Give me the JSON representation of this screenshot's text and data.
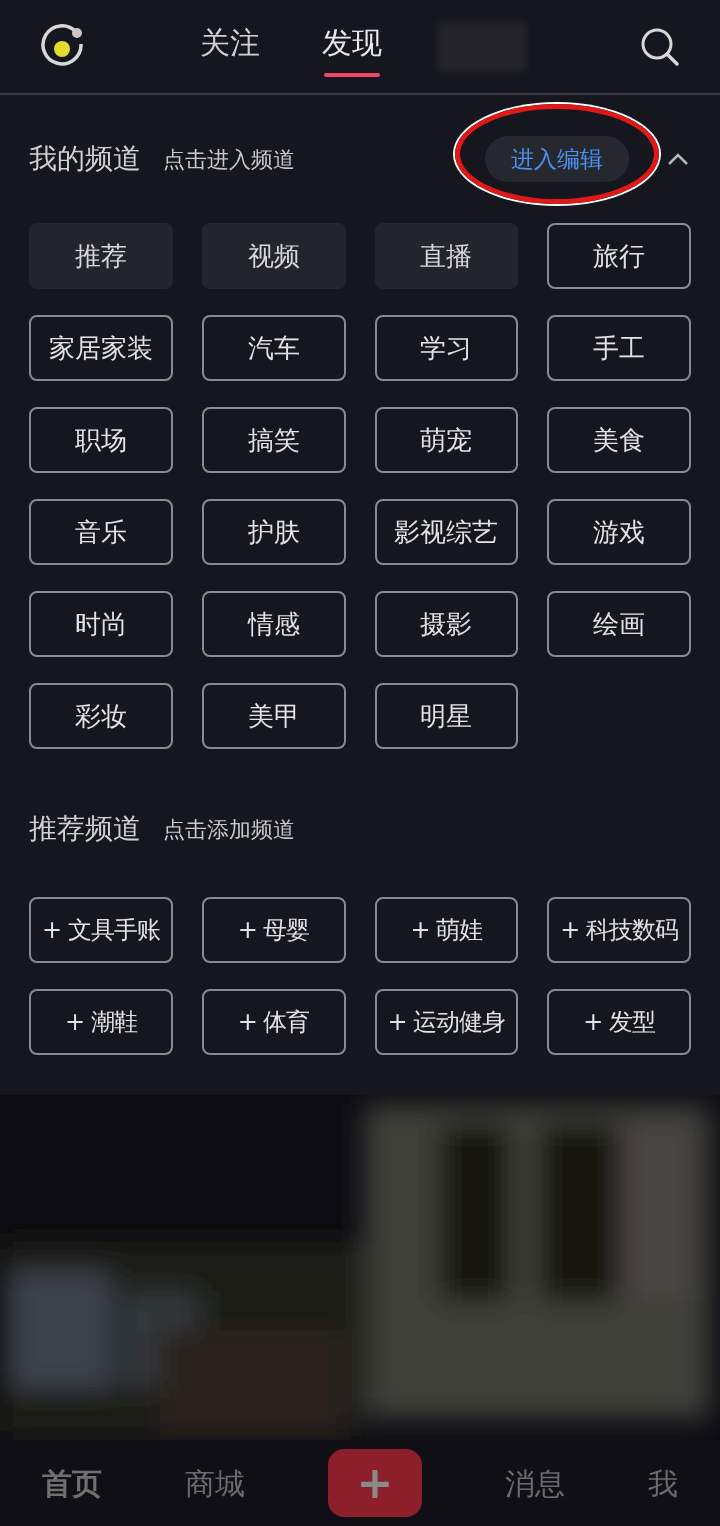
{
  "header": {
    "tabs": [
      {
        "label": "关注",
        "selected": false
      },
      {
        "label": "发现",
        "selected": true
      }
    ]
  },
  "my_channels": {
    "title": "我的频道",
    "hint": "点击进入频道",
    "edit_button": "进入编辑",
    "highlighted": true,
    "expanded": true,
    "items": [
      {
        "label": "推荐",
        "kind": "fixed"
      },
      {
        "label": "视频",
        "kind": "fixed"
      },
      {
        "label": "直播",
        "kind": "fixed"
      },
      {
        "label": "旅行",
        "kind": "editable"
      },
      {
        "label": "家居家装",
        "kind": "editable"
      },
      {
        "label": "汽车",
        "kind": "editable"
      },
      {
        "label": "学习",
        "kind": "editable"
      },
      {
        "label": "手工",
        "kind": "editable"
      },
      {
        "label": "职场",
        "kind": "editable"
      },
      {
        "label": "搞笑",
        "kind": "editable"
      },
      {
        "label": "萌宠",
        "kind": "editable"
      },
      {
        "label": "美食",
        "kind": "editable"
      },
      {
        "label": "音乐",
        "kind": "editable"
      },
      {
        "label": "护肤",
        "kind": "editable"
      },
      {
        "label": "影视综艺",
        "kind": "editable"
      },
      {
        "label": "游戏",
        "kind": "editable"
      },
      {
        "label": "时尚",
        "kind": "editable"
      },
      {
        "label": "情感",
        "kind": "editable"
      },
      {
        "label": "摄影",
        "kind": "editable"
      },
      {
        "label": "绘画",
        "kind": "editable"
      },
      {
        "label": "彩妆",
        "kind": "editable"
      },
      {
        "label": "美甲",
        "kind": "editable"
      },
      {
        "label": "明星",
        "kind": "editable"
      }
    ]
  },
  "recommended_channels": {
    "title": "推荐频道",
    "hint": "点击添加频道",
    "items": [
      "+ 文具手账",
      "+ 母婴",
      "+ 萌娃",
      "+ 科技数码",
      "+ 潮鞋",
      "+ 体育",
      "+ 运动健身",
      "+ 发型"
    ]
  },
  "bottom_nav": {
    "items": [
      {
        "label": "首页",
        "kind": "tab"
      },
      {
        "label": "商城",
        "kind": "tab"
      },
      {
        "label": "+",
        "kind": "create"
      },
      {
        "label": "消息",
        "kind": "tab"
      },
      {
        "label": "我",
        "kind": "tab"
      }
    ]
  }
}
